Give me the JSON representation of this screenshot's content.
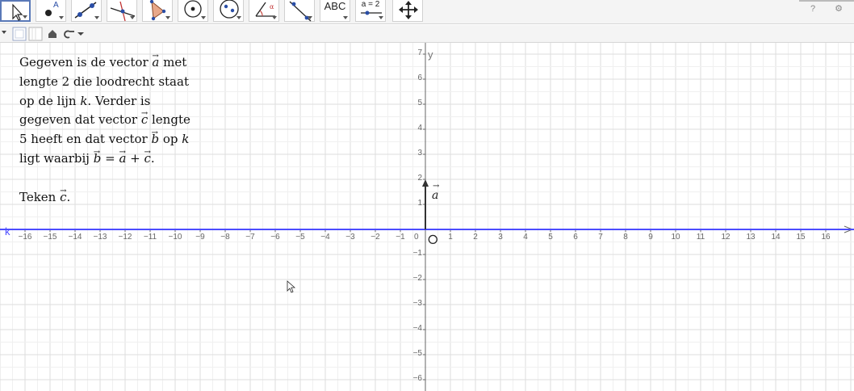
{
  "toolbar": {
    "tools": [
      {
        "name": "move-tool",
        "icon": "arrow-cursor-icon"
      },
      {
        "name": "point-tool",
        "icon": "point-icon"
      },
      {
        "name": "line-tool",
        "icon": "line-through-points-icon"
      },
      {
        "name": "perpendicular-line-tool",
        "icon": "perpendicular-line-icon"
      },
      {
        "name": "polygon-tool",
        "icon": "polygon-icon"
      },
      {
        "name": "circle-tool",
        "icon": "circle-center-point-icon"
      },
      {
        "name": "ellipse-tool",
        "icon": "ellipse-icon"
      },
      {
        "name": "angle-tool",
        "icon": "angle-icon"
      },
      {
        "name": "reflect-tool",
        "icon": "reflect-about-line-icon"
      },
      {
        "name": "text-tool",
        "icon": "text-icon",
        "label": "ABC"
      },
      {
        "name": "slider-tool",
        "icon": "slider-icon",
        "label": "a = 2"
      },
      {
        "name": "move-graphics-view-tool",
        "icon": "move-arrows-icon"
      }
    ],
    "help_icon": "help-icon",
    "settings_icon": "gear-icon"
  },
  "stylebar": {
    "icons": [
      "style-menu-toggle-icon",
      "graphics-view-icon",
      "algebra-view-icon",
      "home-icon",
      "undo-icon",
      "dropdown-icon"
    ]
  },
  "graphics": {
    "x_axis_label": "",
    "y_axis_label": "y",
    "line_label": "k",
    "vector_label": "a",
    "origin_label": "0",
    "x_ticks": [
      -16,
      -15,
      -14,
      -13,
      -12,
      -11,
      -10,
      -9,
      -8,
      -7,
      -6,
      -5,
      -4,
      -3,
      -2,
      -1,
      1,
      2,
      3,
      4,
      5,
      6,
      7,
      8,
      9,
      10,
      11,
      12,
      13,
      14,
      15,
      16
    ],
    "y_ticks": [
      7,
      6,
      5,
      4,
      3,
      2,
      1,
      -1,
      -2,
      -3,
      -4,
      -5,
      -6
    ],
    "xlim": [
      -17,
      17
    ],
    "ylim": [
      -6.5,
      7.3
    ],
    "vector_a": {
      "from": [
        0,
        0
      ],
      "to": [
        0,
        2
      ]
    },
    "point_O": [
      0.3,
      -0.4
    ],
    "colors": {
      "line_k": "#4c4cff",
      "axes": "#666666",
      "grid": "#e4e4e4",
      "vector": "#333333"
    }
  },
  "problem": {
    "lines": [
      {
        "pre": "Gegeven is de vector ",
        "vec": "a",
        "post": " met"
      },
      {
        "pre": "lengte 2 die loodrecht staat",
        "vec": "",
        "post": ""
      },
      {
        "pre": "op de lijn ",
        "it": "k",
        "post": ". Verder is"
      },
      {
        "pre": "gegeven dat vector ",
        "vec": "c",
        "post": " lengte"
      },
      {
        "pre": "5 heeft en dat vector ",
        "vec": "b",
        "post": " op ",
        "it2": "k"
      },
      {
        "pre": "ligt waarbij ",
        "eq": true
      }
    ],
    "task": {
      "pre": "Teken ",
      "vec": "c",
      "post": "."
    }
  }
}
